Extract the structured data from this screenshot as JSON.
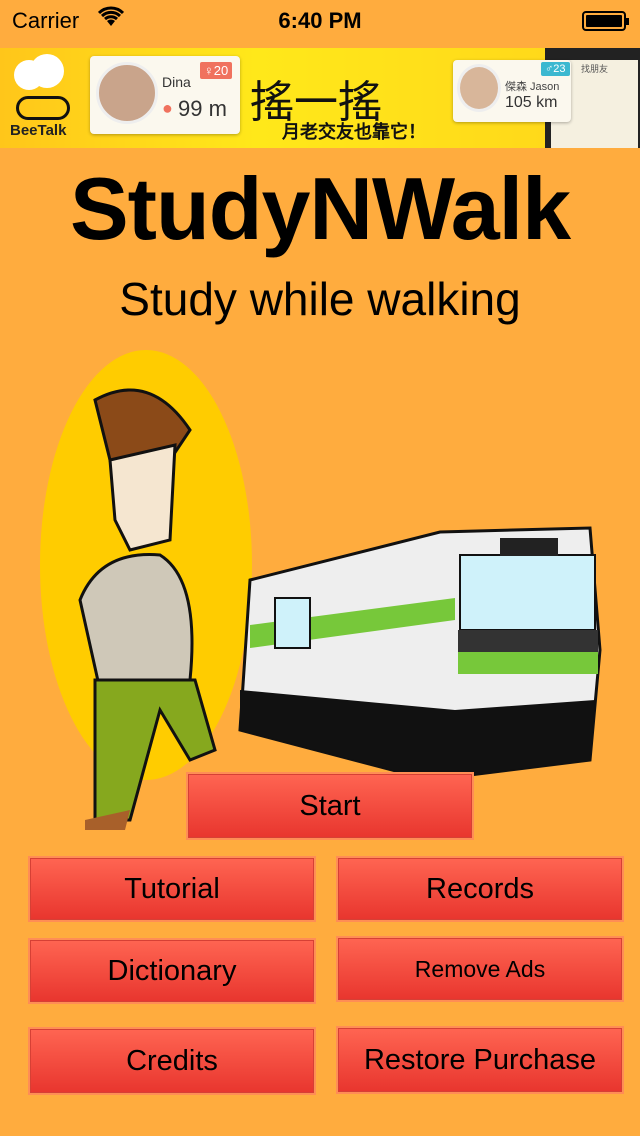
{
  "status_bar": {
    "carrier": "Carrier",
    "time": "6:40 PM"
  },
  "ad": {
    "brand": "BeeTalk",
    "user1_name": "Dina",
    "user1_badge": "♀20",
    "user1_distance": "99 m",
    "headline": "搖一搖",
    "tagline": "月老交友也靠它！",
    "user2_name": "傑森 Jason",
    "user2_badge": "♂23",
    "user2_distance": "105 km",
    "phone_header": "找朋友"
  },
  "app": {
    "title": "StudyNWalk",
    "subtitle": "Study while walking"
  },
  "buttons": {
    "start": "Start",
    "tutorial": "Tutorial",
    "records": "Records",
    "dictionary": "Dictionary",
    "remove_ads": "Remove Ads",
    "credits": "Credits",
    "restore_purchase": "Restore Purchase"
  },
  "colors": {
    "background": "#FFAC3E",
    "button": "#F0473A"
  }
}
